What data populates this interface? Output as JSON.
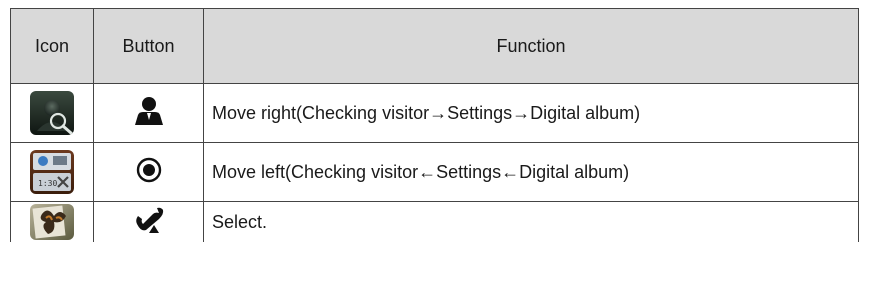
{
  "table": {
    "headers": {
      "icon": "Icon",
      "button": "Button",
      "function": "Function"
    },
    "rows": [
      {
        "icon": "checking-visitor-app-icon",
        "button": "person-icon",
        "function": "Move right(Checking visitor→Settings→Digital album)"
      },
      {
        "icon": "settings-app-icon",
        "button": "record-circle-icon",
        "function": "Move left(Checking visitor←Settings←Digital album)"
      },
      {
        "icon": "digital-album-app-icon",
        "button": "phone-handset-icon",
        "function": "Select."
      }
    ]
  },
  "colors": {
    "header_bg": "#d9d9d9",
    "border": "#444444",
    "text": "#1a1a1a"
  }
}
